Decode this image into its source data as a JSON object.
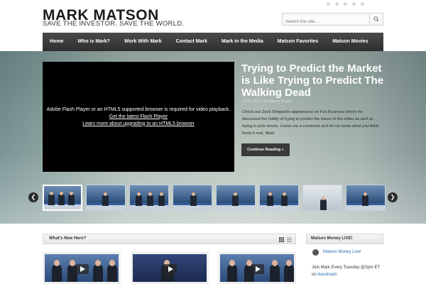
{
  "header": {
    "title": "MARK MATSON",
    "tagline": "SAVE THE INVESTOR. SAVE THE WORLD.",
    "search_placeholder": "Search this site..."
  },
  "nav": {
    "items": [
      "Home",
      "Who is Mark?",
      "Work With Mark",
      "Contact Mark",
      "Mark in the Media",
      "Matson Favorites",
      "Matson Movies"
    ]
  },
  "hero": {
    "video_message": "Adobe Flash Player or an HTML5 supported browser is required for video playback.",
    "video_link1": "Get the latest Flash Player",
    "video_link2": "Learn more about upgrading to an HTML5 browser",
    "headline": "Trying to Predict the Market is Like Trying to Predict The Walking Dead",
    "meta": "Oct 8, 2013 · by Matson Money",
    "excerpt": "Check out Zack Shepard's appearance on Fox Business where he discussed the futility of trying to predict the future of the dollar as well as trying to pick stocks. Leave me a comment and let me know what you think. Keep it real, Mark",
    "continue_label": "Continue Reading »",
    "prev_arrow": "❮",
    "next_arrow": "❯"
  },
  "lower": {
    "new_title": "What's New Here?",
    "live_title": "Matson Money LIVE!",
    "live_link": "Matson Money Live!",
    "live_text": "Join Mark Every Tuesday @3pm ET on ",
    "live_text_link": "livestream"
  },
  "colors": {
    "nav_bg": "#3a3a3a",
    "link": "#2a6fb3",
    "button_bg": "#3a3a3a"
  }
}
